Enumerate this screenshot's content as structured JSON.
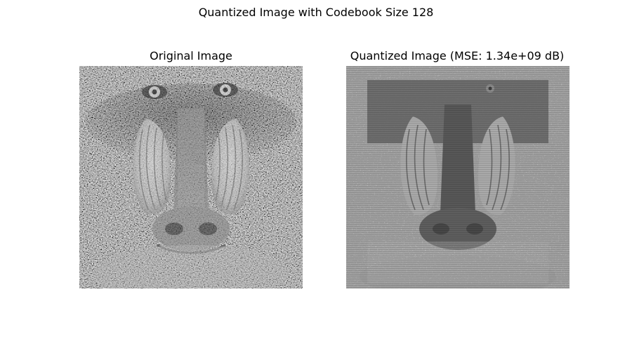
{
  "figure": {
    "title": "Quantized Image with Codebook Size 128"
  },
  "panels": [
    {
      "title": "Original Image",
      "image": "mandrill-grayscale-photo"
    },
    {
      "title": "Quantized Image (MSE: 1.34e+09 dB)",
      "image": "mandrill-quantized-photo"
    }
  ],
  "colors": {
    "background": "#ffffff",
    "text": "#000000"
  }
}
